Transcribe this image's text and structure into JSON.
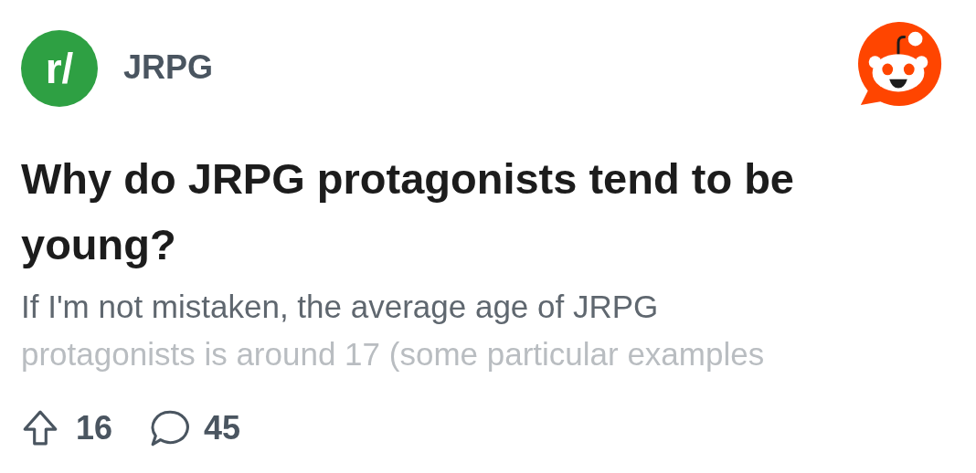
{
  "subreddit": {
    "avatar_text": "r/",
    "name": "JRPG"
  },
  "post": {
    "title": "Why do JRPG protagonists tend to be young?",
    "body_lines": [
      "If I'm not mistaken, the average age of JRPG",
      "protagonists is around 17 (some particular examples"
    ]
  },
  "footer": {
    "upvotes": "16",
    "comments": "45"
  }
}
